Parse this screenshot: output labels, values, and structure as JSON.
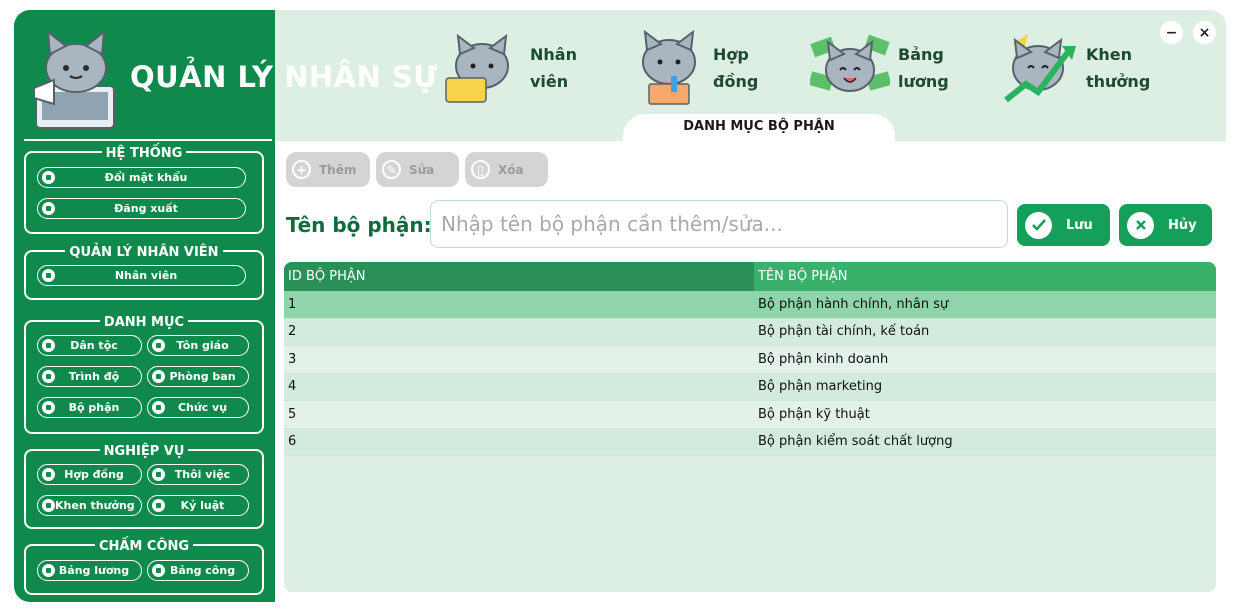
{
  "app": {
    "title": "QUẢN LÝ NHÂN SỰ"
  },
  "sidebar": {
    "groups": [
      {
        "title": "HỆ THỐNG",
        "buttons": [
          "Đổi mật khẩu",
          "Đăng xuất"
        ]
      },
      {
        "title": "QUẢN LÝ NHÂN VIÊN",
        "buttons": [
          "Nhân viên"
        ]
      },
      {
        "title": "DANH MỤC",
        "buttons": [
          "Dân tộc",
          "Tôn giáo",
          "Trình độ",
          "Phòng ban",
          "Bộ phận",
          "Chức vụ"
        ]
      },
      {
        "title": "NGHIỆP VỤ",
        "buttons": [
          "Hợp đồng",
          "Thôi việc",
          "Khen thưởng",
          "Kỷ luật"
        ]
      },
      {
        "title": "CHẤM CÔNG",
        "buttons": [
          "Bảng lương",
          "Bảng công"
        ]
      }
    ]
  },
  "nav": {
    "items": [
      {
        "label": "Nhân\nviên",
        "icon": "cat-laptop-icon"
      },
      {
        "label": "Hợp\nđồng",
        "icon": "cat-contract-icon"
      },
      {
        "label": "Bảng\nlương",
        "icon": "cat-money-icon"
      },
      {
        "label": "Khen\nthưởng",
        "icon": "cat-trophy-icon"
      }
    ],
    "active_tab": "DANH MỤC BỘ PHẬN"
  },
  "window": {
    "minimize": "−",
    "close": "×"
  },
  "toolbar": {
    "add": "Thêm",
    "edit": "Sửa",
    "delete": "Xóa"
  },
  "form": {
    "label": "Tên bộ phận:",
    "placeholder": "Nhập tên bộ phận cần thêm/sửa...",
    "save": "Lưu",
    "cancel": "Hủy"
  },
  "table": {
    "headers": [
      "ID BỘ PHẬN",
      "TÊN BỘ PHẬN"
    ],
    "rows": [
      [
        "1",
        "Bộ phận hành chính, nhân sự"
      ],
      [
        "2",
        "Bộ phận tài chính, kế toán"
      ],
      [
        "3",
        "Bộ phận kinh doanh"
      ],
      [
        "4",
        "Bộ phận marketing"
      ],
      [
        "5",
        "Bộ phận kỹ thuật"
      ],
      [
        "6",
        "Bộ phận kiểm soát chất lượng"
      ]
    ],
    "selected_row": 0
  },
  "colors": {
    "brand": "#0f8a4c",
    "accent": "#14a05a",
    "header_bg": "#dcefe2"
  }
}
